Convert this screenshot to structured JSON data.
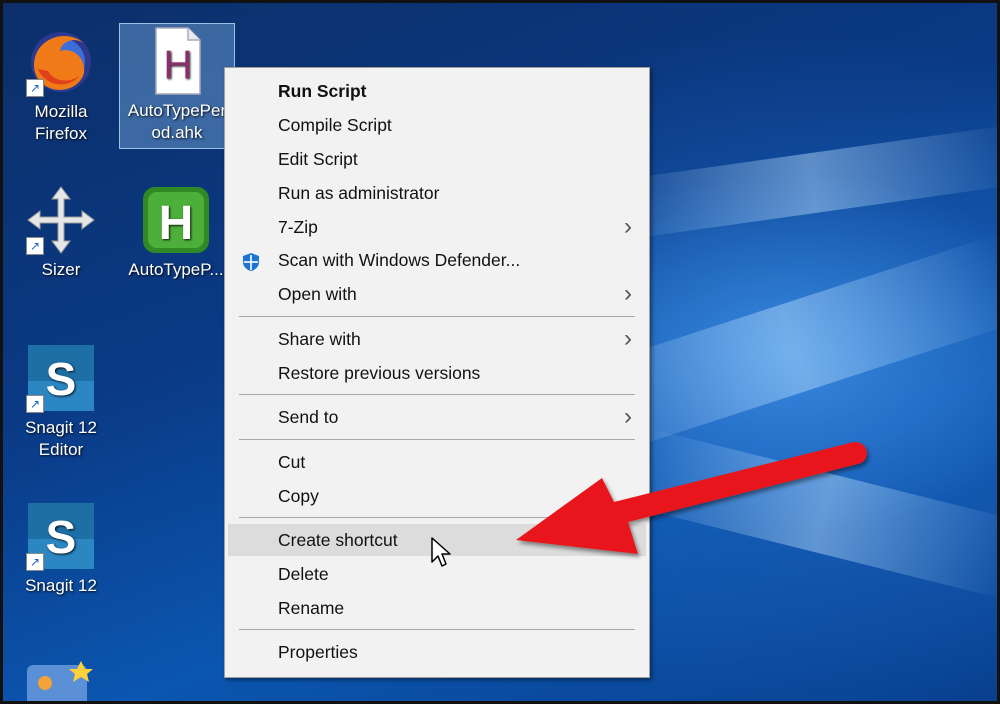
{
  "desktop": {
    "icons": [
      {
        "label_1": "Mozilla",
        "label_2": "Firefox",
        "icon": "firefox-icon"
      },
      {
        "label_1": "AutoTypePer",
        "label_2": "od.ahk",
        "icon": "ahk-script-file-icon",
        "selected": true
      },
      {
        "label_1": "Sizer",
        "icon": "sizer-move-icon"
      },
      {
        "label_1": "AutoTypeP...",
        "icon": "autohotkey-icon"
      },
      {
        "label_1": "Snagit 12",
        "label_2": "Editor",
        "icon": "snagit-icon"
      },
      {
        "label_1": "Snagit 12",
        "icon": "snagit-icon"
      }
    ]
  },
  "context_menu": {
    "items": [
      {
        "label": "Run Script",
        "bold": true
      },
      {
        "label": "Compile Script"
      },
      {
        "label": "Edit Script"
      },
      {
        "label": "Run as administrator"
      },
      {
        "label": "7-Zip",
        "submenu": true
      },
      {
        "label": "Scan with Windows Defender...",
        "icon": "windows-defender-icon"
      },
      {
        "label": "Open with",
        "submenu": true
      },
      {
        "label": "Share with",
        "submenu": true
      },
      {
        "label": "Restore previous versions"
      },
      {
        "label": "Send to",
        "submenu": true
      },
      {
        "label": "Cut"
      },
      {
        "label": "Copy"
      },
      {
        "label": "Create shortcut",
        "highlighted": true
      },
      {
        "label": "Delete"
      },
      {
        "label": "Rename"
      },
      {
        "label": "Properties"
      }
    ],
    "chevron_glyph": "›"
  },
  "annotation": {
    "arrow_color": "#e8191c"
  }
}
